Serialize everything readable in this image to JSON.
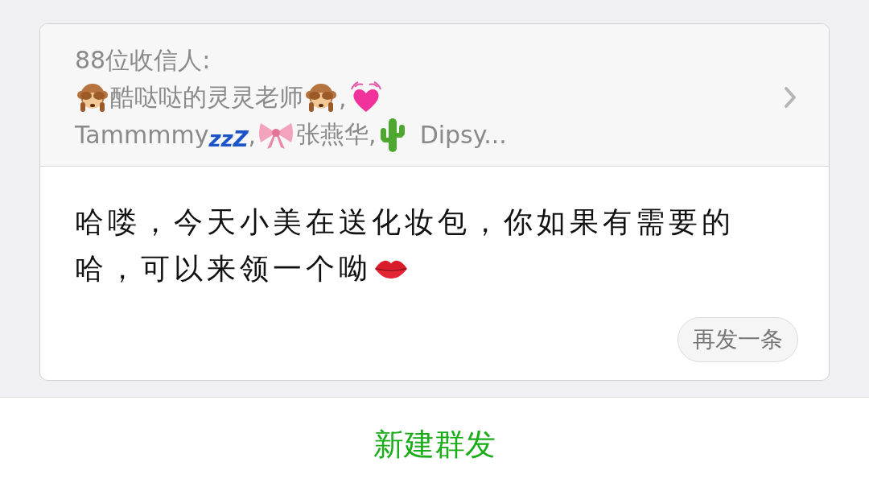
{
  "recipients": {
    "label": "88位收信人:",
    "lines": [
      [
        {
          "kind": "monkey"
        },
        {
          "kind": "text",
          "text": "酷哒哒的灵灵老师"
        },
        {
          "kind": "monkey"
        },
        {
          "kind": "text",
          "text": ","
        },
        {
          "kind": "heart"
        }
      ],
      [
        {
          "kind": "text",
          "text": "Tammmmy"
        },
        {
          "kind": "sleep",
          "text": "zzZ"
        },
        {
          "kind": "text",
          "text": ","
        },
        {
          "kind": "bow"
        },
        {
          "kind": "text",
          "text": "张燕华,"
        },
        {
          "kind": "cactus"
        },
        {
          "kind": "text",
          "text": "Dipsy..."
        }
      ]
    ]
  },
  "message": [
    [
      {
        "kind": "text",
        "text": "哈喽，今天小美在送化妆包，你如果有需要的"
      }
    ],
    [
      {
        "kind": "text",
        "text": "哈，可以来领一个呦"
      },
      {
        "kind": "lips"
      }
    ]
  ],
  "resend_button": "再发一条",
  "new_broadcast_button": "新建群发"
}
